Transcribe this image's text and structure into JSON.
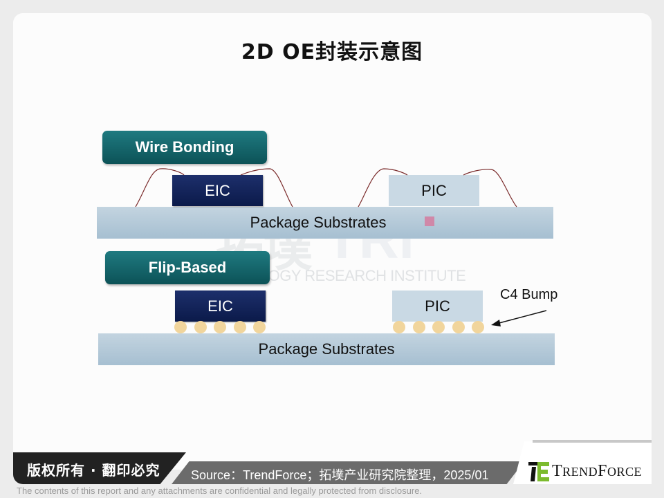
{
  "title": "2D OE封装示意图",
  "watermark": {
    "cn": "拓墣",
    "abbr": "TRI",
    "en": "TOPOLOGY RESEARCH INSTITUTE"
  },
  "diagram": {
    "wire_bonding": {
      "label": "Wire Bonding",
      "eic_label": "EIC",
      "pic_label": "PIC",
      "substrate_label": "Package Substrates"
    },
    "flip_based": {
      "label": "Flip-Based",
      "eic_label": "EIC",
      "pic_label": "PIC",
      "substrate_label": "Package Substrates",
      "bump_label": "C4 Bump",
      "bumps_per_chip": 5
    },
    "colors": {
      "label_tag": "#0f5f64",
      "eic": "#0f1f55",
      "pic": "#c9d9e4",
      "substrate": "#b3c9d8",
      "bump": "#f1d59c",
      "wire": "#7a2a2a",
      "marker": "#d088a8"
    }
  },
  "footer": {
    "copyright": "版权所有 · 翻印必究",
    "source": "Source：TrendForce；拓墣产业研究院整理，2025/01",
    "brand": "TrendForce",
    "disclaimer": "The contents of this report and any attachments are confidential and legally protected from disclosure."
  }
}
